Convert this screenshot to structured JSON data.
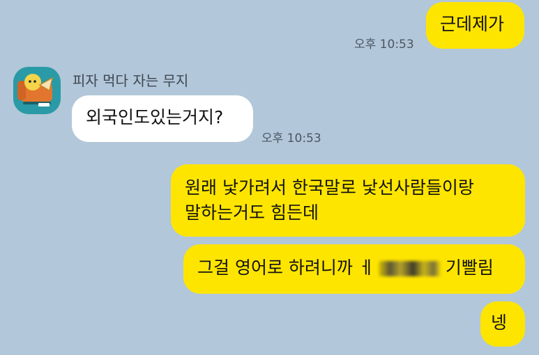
{
  "chat": {
    "messages": [
      {
        "id": "m1",
        "direction": "outgoing",
        "text": "근데제가",
        "time": "오후 10:53"
      },
      {
        "id": "m2",
        "direction": "incoming",
        "sender": "피자 먹다 자는 무지",
        "text": "외국인도있는거지?",
        "time": "오후 10:53"
      },
      {
        "id": "m3",
        "direction": "outgoing",
        "line1": "원래 낯가려서 한국말로 낯선사람들이랑",
        "line2": "말하는거도 힘든데"
      },
      {
        "id": "m4",
        "direction": "outgoing",
        "text_before": "그걸 영어로 하려니까 ㅔ",
        "text_after": "기빨림",
        "redacted": true
      },
      {
        "id": "m5",
        "direction": "outgoing",
        "text": "넹"
      }
    ]
  },
  "colors": {
    "background": "#b2c7d9",
    "outgoing_bubble": "#fee500",
    "incoming_bubble": "#ffffff",
    "avatar_bg": "#2a9aa6"
  },
  "icons": {
    "avatar": "muzi-pizza-avatar-icon"
  }
}
